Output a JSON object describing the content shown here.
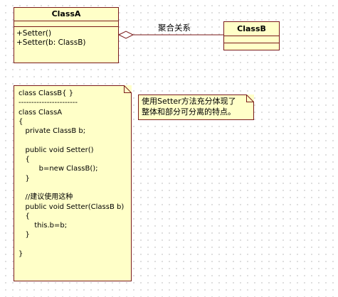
{
  "class_a": {
    "name": "ClassA",
    "operations": [
      "+Setter()",
      "+Setter(b: ClassB)"
    ]
  },
  "class_b": {
    "name": "ClassB"
  },
  "association": {
    "label": "聚合关系",
    "kind": "aggregation"
  },
  "code_note": {
    "lines": [
      "class ClassB{ }",
      "-----------------------",
      "class ClassA",
      "{",
      "   private ClassB b;",
      "",
      "   public void Setter()",
      "   {",
      "         b=new ClassB();",
      "   }",
      "",
      "   //建议使用这种",
      "   public void Setter(ClassB b)",
      "   {",
      "       this.b=b;",
      "   }",
      "",
      "}"
    ]
  },
  "comment_note": {
    "lines": [
      "使用Setter方法充分体现了",
      "整体和部分可分离的特点。"
    ]
  },
  "colors": {
    "fill": "#ffffc8",
    "border": "#7a1a1a",
    "grid_dot": "#c9c9c9"
  }
}
